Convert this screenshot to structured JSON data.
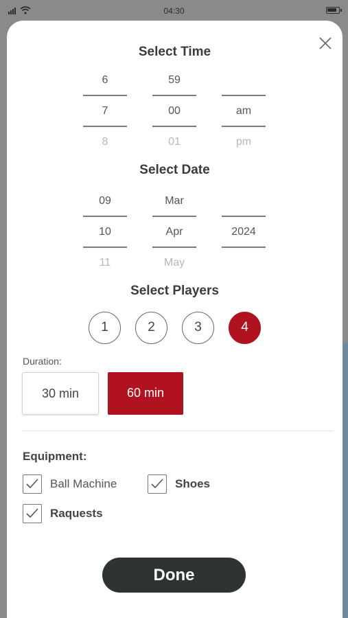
{
  "status_bar": {
    "time": "04:30"
  },
  "modal": {
    "time_section": {
      "title": "Select Time",
      "hours": [
        "6",
        "7",
        "8"
      ],
      "minutes": [
        "59",
        "00",
        "01"
      ],
      "period": [
        "",
        "am",
        "pm"
      ],
      "selected": {
        "hour": "7",
        "minute": "00",
        "period": "am"
      }
    },
    "date_section": {
      "title": "Select Date",
      "days": [
        "09",
        "10",
        "11"
      ],
      "months": [
        "Mar",
        "Apr",
        "May"
      ],
      "years": [
        "",
        "2024",
        ""
      ],
      "selected": {
        "day": "10",
        "month": "Apr",
        "year": "2024"
      }
    },
    "players_section": {
      "title": "Select Players",
      "options": [
        "1",
        "2",
        "3",
        "4"
      ],
      "selected": "4"
    },
    "duration": {
      "label": "Duration:",
      "options": [
        "30 min",
        "60 min"
      ],
      "selected": "60 min"
    },
    "equipment": {
      "label": "Equipment:",
      "items": [
        {
          "label": "Ball Machine",
          "checked": true
        },
        {
          "label": "Shoes",
          "checked": true
        },
        {
          "label": "Raquests",
          "checked": true
        }
      ]
    },
    "done_label": "Done"
  },
  "colors": {
    "accent": "#b01220",
    "done_button": "#2e3432"
  }
}
